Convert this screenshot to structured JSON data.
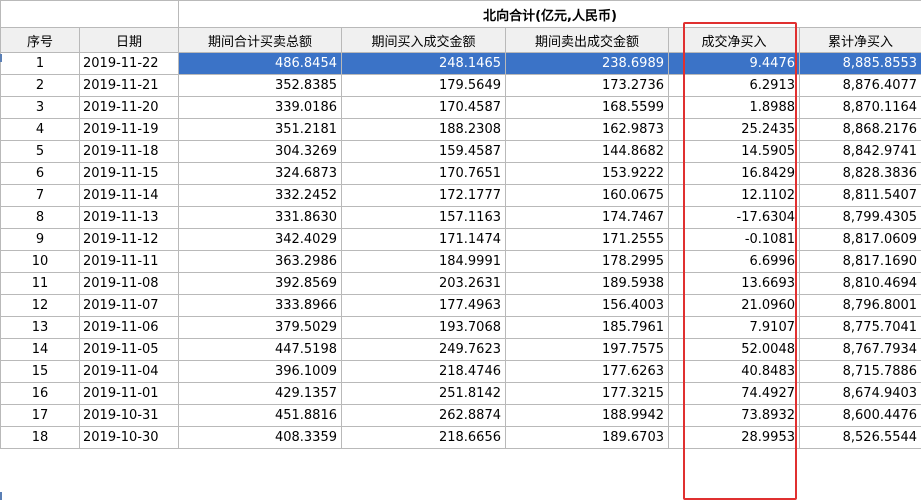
{
  "group_header": "北向合计(亿元,人民币)",
  "columns": [
    "序号",
    "日期",
    "期间合计买卖总额",
    "期间买入成交金额",
    "期间卖出成交金额",
    "成交净买入",
    "累计净买入"
  ],
  "rows": [
    [
      "1",
      "2019-11-22",
      "486.8454",
      "248.1465",
      "238.6989",
      "9.4476",
      "8,885.8553"
    ],
    [
      "2",
      "2019-11-21",
      "352.8385",
      "179.5649",
      "173.2736",
      "6.2913",
      "8,876.4077"
    ],
    [
      "3",
      "2019-11-20",
      "339.0186",
      "170.4587",
      "168.5599",
      "1.8988",
      "8,870.1164"
    ],
    [
      "4",
      "2019-11-19",
      "351.2181",
      "188.2308",
      "162.9873",
      "25.2435",
      "8,868.2176"
    ],
    [
      "5",
      "2019-11-18",
      "304.3269",
      "159.4587",
      "144.8682",
      "14.5905",
      "8,842.9741"
    ],
    [
      "6",
      "2019-11-15",
      "324.6873",
      "170.7651",
      "153.9222",
      "16.8429",
      "8,828.3836"
    ],
    [
      "7",
      "2019-11-14",
      "332.2452",
      "172.1777",
      "160.0675",
      "12.1102",
      "8,811.5407"
    ],
    [
      "8",
      "2019-11-13",
      "331.8630",
      "157.1163",
      "174.7467",
      "-17.6304",
      "8,799.4305"
    ],
    [
      "9",
      "2019-11-12",
      "342.4029",
      "171.1474",
      "171.2555",
      "-0.1081",
      "8,817.0609"
    ],
    [
      "10",
      "2019-11-11",
      "363.2986",
      "184.9991",
      "178.2995",
      "6.6996",
      "8,817.1690"
    ],
    [
      "11",
      "2019-11-08",
      "392.8569",
      "203.2631",
      "189.5938",
      "13.6693",
      "8,810.4694"
    ],
    [
      "12",
      "2019-11-07",
      "333.8966",
      "177.4963",
      "156.4003",
      "21.0960",
      "8,796.8001"
    ],
    [
      "13",
      "2019-11-06",
      "379.5029",
      "193.7068",
      "185.7961",
      "7.9107",
      "8,775.7041"
    ],
    [
      "14",
      "2019-11-05",
      "447.5198",
      "249.7623",
      "197.7575",
      "52.0048",
      "8,767.7934"
    ],
    [
      "15",
      "2019-11-04",
      "396.1009",
      "218.4746",
      "177.6263",
      "40.8483",
      "8,715.7886"
    ],
    [
      "16",
      "2019-11-01",
      "429.1357",
      "251.8142",
      "177.3215",
      "74.4927",
      "8,674.9403"
    ],
    [
      "17",
      "2019-10-31",
      "451.8816",
      "262.8874",
      "188.9942",
      "73.8932",
      "8,600.4476"
    ],
    [
      "18",
      "2019-10-30",
      "408.3359",
      "218.6656",
      "189.6703",
      "28.9953",
      "8,526.5544"
    ]
  ],
  "selected_row_index": 0,
  "highlight_color": "#e03030",
  "selection_color": "#3b73c7"
}
